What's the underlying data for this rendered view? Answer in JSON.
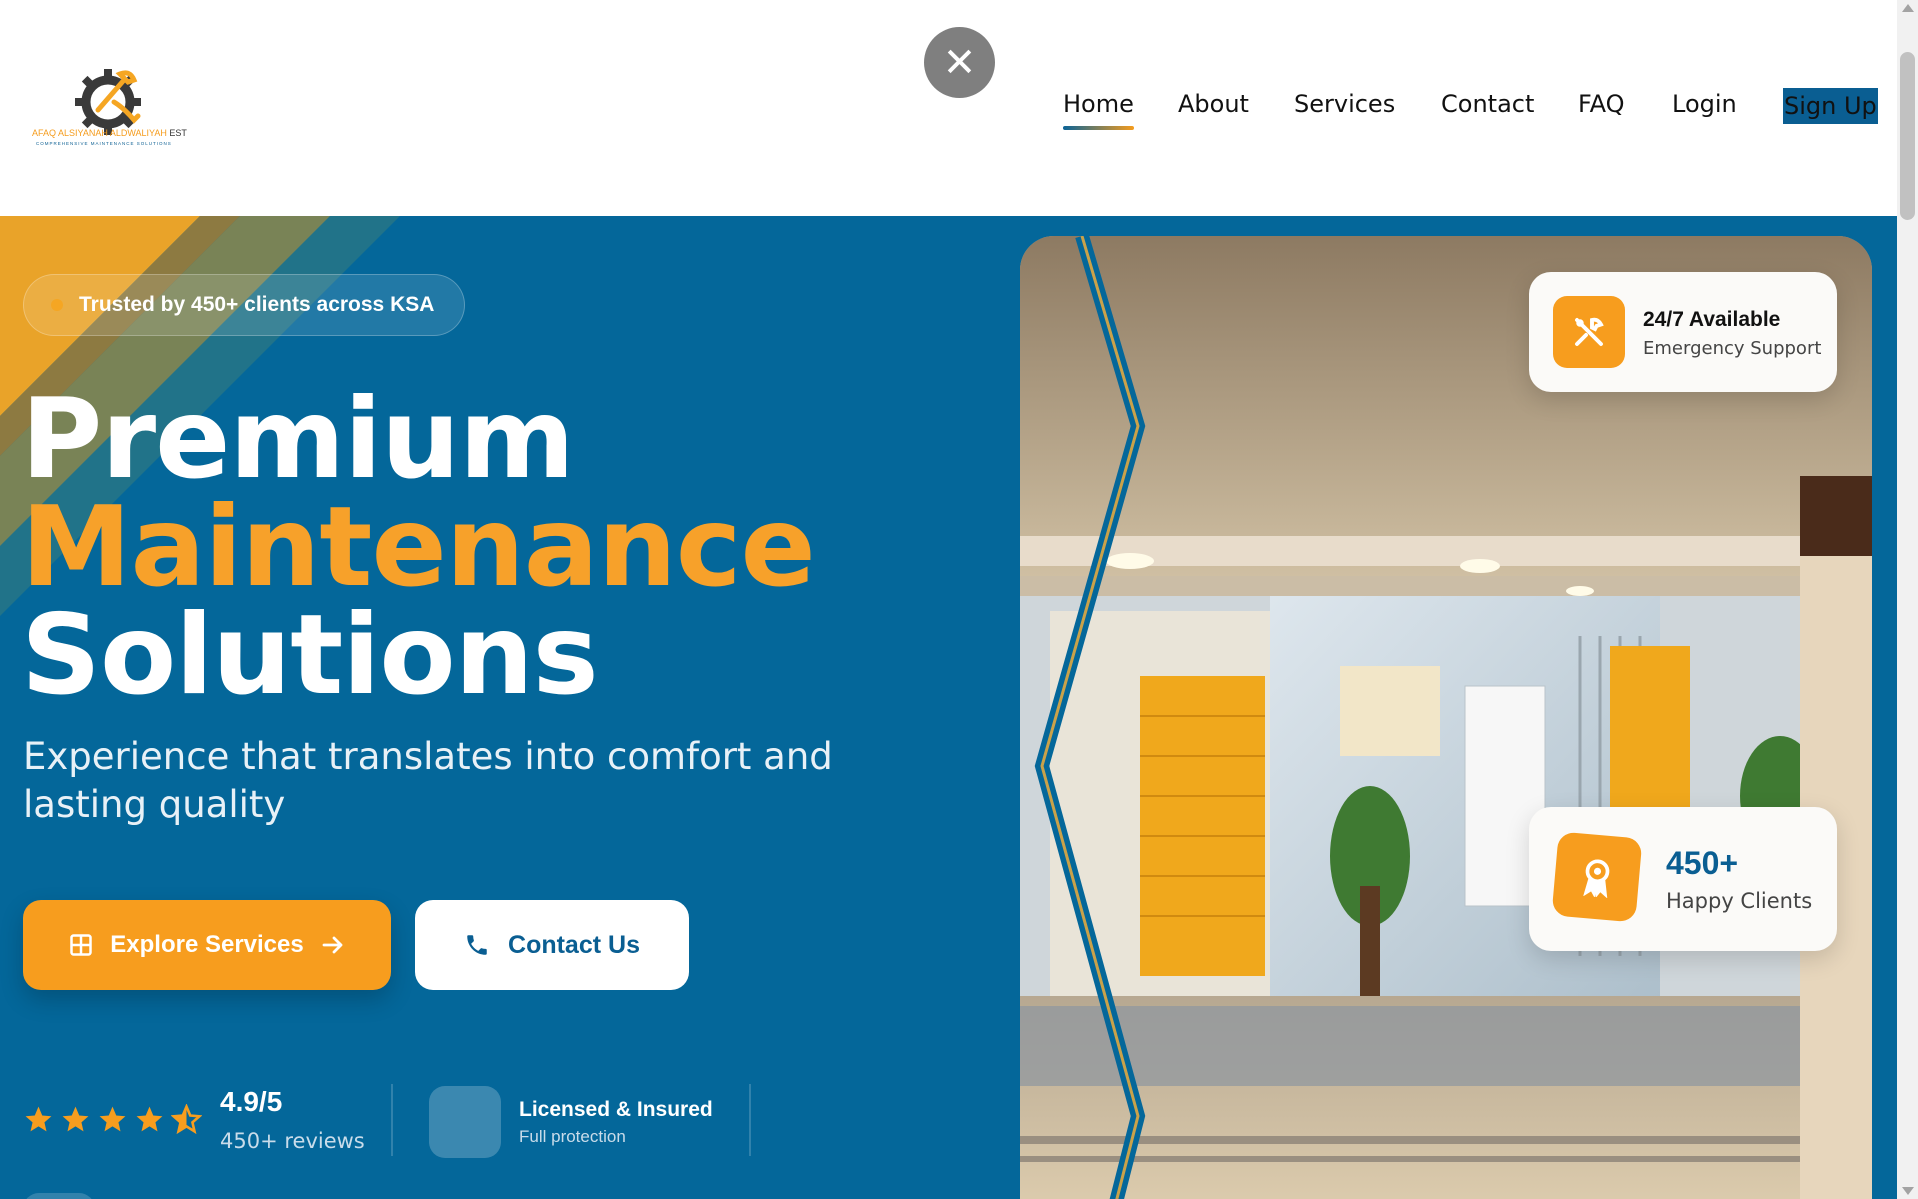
{
  "logo": {
    "name_orange": "AFAQ ALSIYANAH ALDWALIYAH",
    "name_dark": "EST",
    "tagline": "COMPREHENSIVE MAINTENANCE SOLUTIONS"
  },
  "close_label": "✕",
  "nav": {
    "home": "Home",
    "about": "About",
    "services": "Services",
    "contact": "Contact",
    "faq": "FAQ",
    "login": "Login",
    "signup": "Sign Up",
    "active": "Home"
  },
  "hero": {
    "badge": "Trusted by 450+ clients across KSA",
    "headline_line1": "Premium",
    "headline_line2": "Maintenance",
    "headline_line3": "Solutions",
    "subtitle": "Experience that translates into comfort and lasting quality",
    "explore_button": "Explore Services",
    "contact_button": "Contact Us",
    "rating_value": "4.9/5",
    "rating_count": "450+ reviews",
    "stars": 4.5,
    "licensed_title": "Licensed & Insured",
    "licensed_sub": "Full protection"
  },
  "cards": {
    "availability_title": "24/7 Available",
    "availability_sub": "Emergency Support",
    "clients_title": "450+",
    "clients_sub": "Happy Clients"
  },
  "colors": {
    "brand_blue": "#04679a",
    "brand_orange": "#f79d1e",
    "white": "#ffffff"
  },
  "icons": [
    "close-icon",
    "grid-icon",
    "arrow-right-icon",
    "phone-icon",
    "star-icon",
    "star-half-icon",
    "tools-icon",
    "award-icon"
  ]
}
